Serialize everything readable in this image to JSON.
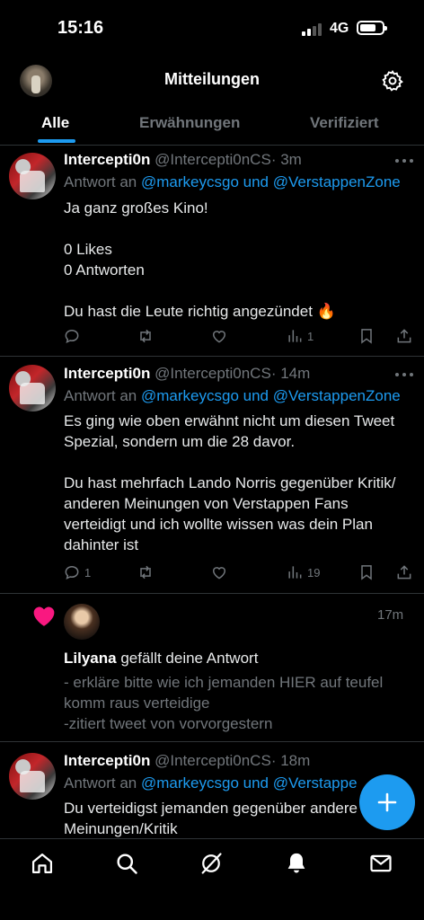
{
  "status_bar": {
    "time": "15:16",
    "network": "4G"
  },
  "header": {
    "title": "Mitteilungen"
  },
  "tabs": [
    {
      "label": "Alle"
    },
    {
      "label": "Erwähnungen"
    },
    {
      "label": "Verifiziert"
    }
  ],
  "posts": [
    {
      "name": "Intercepti0n",
      "handle": "@Intercepti0nCS",
      "time": "· 3m",
      "reply_prefix": "Antwort an",
      "reply_to": "@markeycsgo und @VerstappenZone",
      "lines": [
        "Ja ganz großes Kino!",
        "",
        "0 Likes",
        "0 Antworten",
        "",
        "Du hast die Leute richtig angezündet 🔥"
      ],
      "replies": "",
      "views": "1"
    },
    {
      "name": "Intercepti0n",
      "handle": "@Intercepti0nCS",
      "time": "· 14m",
      "reply_prefix": "Antwort an",
      "reply_to": "@markeycsgo und @VerstappenZone",
      "lines": [
        "Es ging wie oben erwähnt nicht um diesen Tweet",
        "Spezial, sondern um die 28 davor.",
        "",
        "Du hast mehrfach Lando Norris gegenüber Kritik/",
        "anderen Meinungen von Verstappen Fans",
        "verteidigt und ich wollte wissen was dein Plan",
        "dahinter ist"
      ],
      "replies": "1",
      "views": "19"
    },
    {
      "name": "Intercepti0n",
      "handle": "@Intercepti0nCS",
      "time": "· 18m",
      "reply_prefix": "Antwort an",
      "reply_to": "@markeycsgo und @Verstappe",
      "lines": [
        "Du verteidigst jemanden gegenüber andere",
        "Meinungen/Kritik"
      ]
    }
  ],
  "like_notification": {
    "user": "Lilyana",
    "action": "gefällt deine Antwort",
    "time": "17m",
    "lines": [
      "- erkläre bitte wie ich jemanden HIER auf teufel",
      "komm raus verteidige",
      "-zitiert tweet von vorvorgestern"
    ]
  },
  "colors": {
    "accent": "#1d9bf0",
    "like": "#f91880",
    "muted": "#71767b",
    "background": "#000000"
  }
}
